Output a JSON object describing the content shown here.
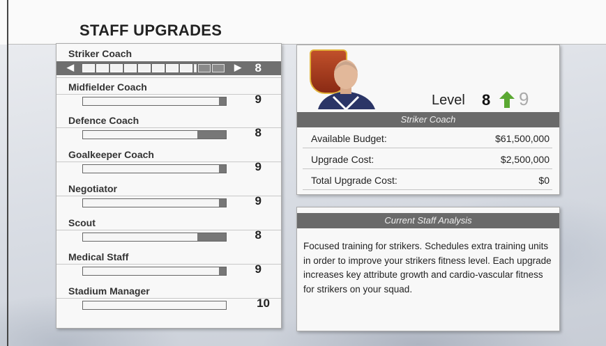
{
  "page": {
    "title": "STAFF UPGRADES"
  },
  "staff": [
    {
      "name": "Striker Coach",
      "level": "8",
      "fill": 0.8,
      "selected": true
    },
    {
      "name": "Midfielder Coach",
      "level": "9",
      "fill": 0.9
    },
    {
      "name": "Defence Coach",
      "level": "8",
      "fill": 0.8
    },
    {
      "name": "Goalkeeper Coach",
      "level": "9",
      "fill": 0.9
    },
    {
      "name": "Negotiator",
      "level": "9",
      "fill": 0.9
    },
    {
      "name": "Scout",
      "level": "8",
      "fill": 0.8
    },
    {
      "name": "Medical Staff",
      "level": "9",
      "fill": 0.9
    },
    {
      "name": "Stadium Manager",
      "level": "10",
      "fill": 1.0
    }
  ],
  "detail": {
    "level_label": "Level",
    "current_level": "8",
    "next_level": "9",
    "role": "Striker Coach",
    "rows": [
      {
        "label": "Available Budget:",
        "value": "$61,500,000"
      },
      {
        "label": "Upgrade Cost:",
        "value": "$2,500,000"
      },
      {
        "label": "Total Upgrade Cost:",
        "value": "$0"
      }
    ]
  },
  "analysis": {
    "header": "Current Staff Analysis",
    "text": "Focused training for strikers. Schedules extra training units in order to improve your strikers fitness level. Each upgrade increases key attribute growth and cardio-vascular fitness for strikers on your squad."
  },
  "colors": {
    "arrow_green": "#5aa832",
    "header_gray": "#6a6a6a"
  }
}
